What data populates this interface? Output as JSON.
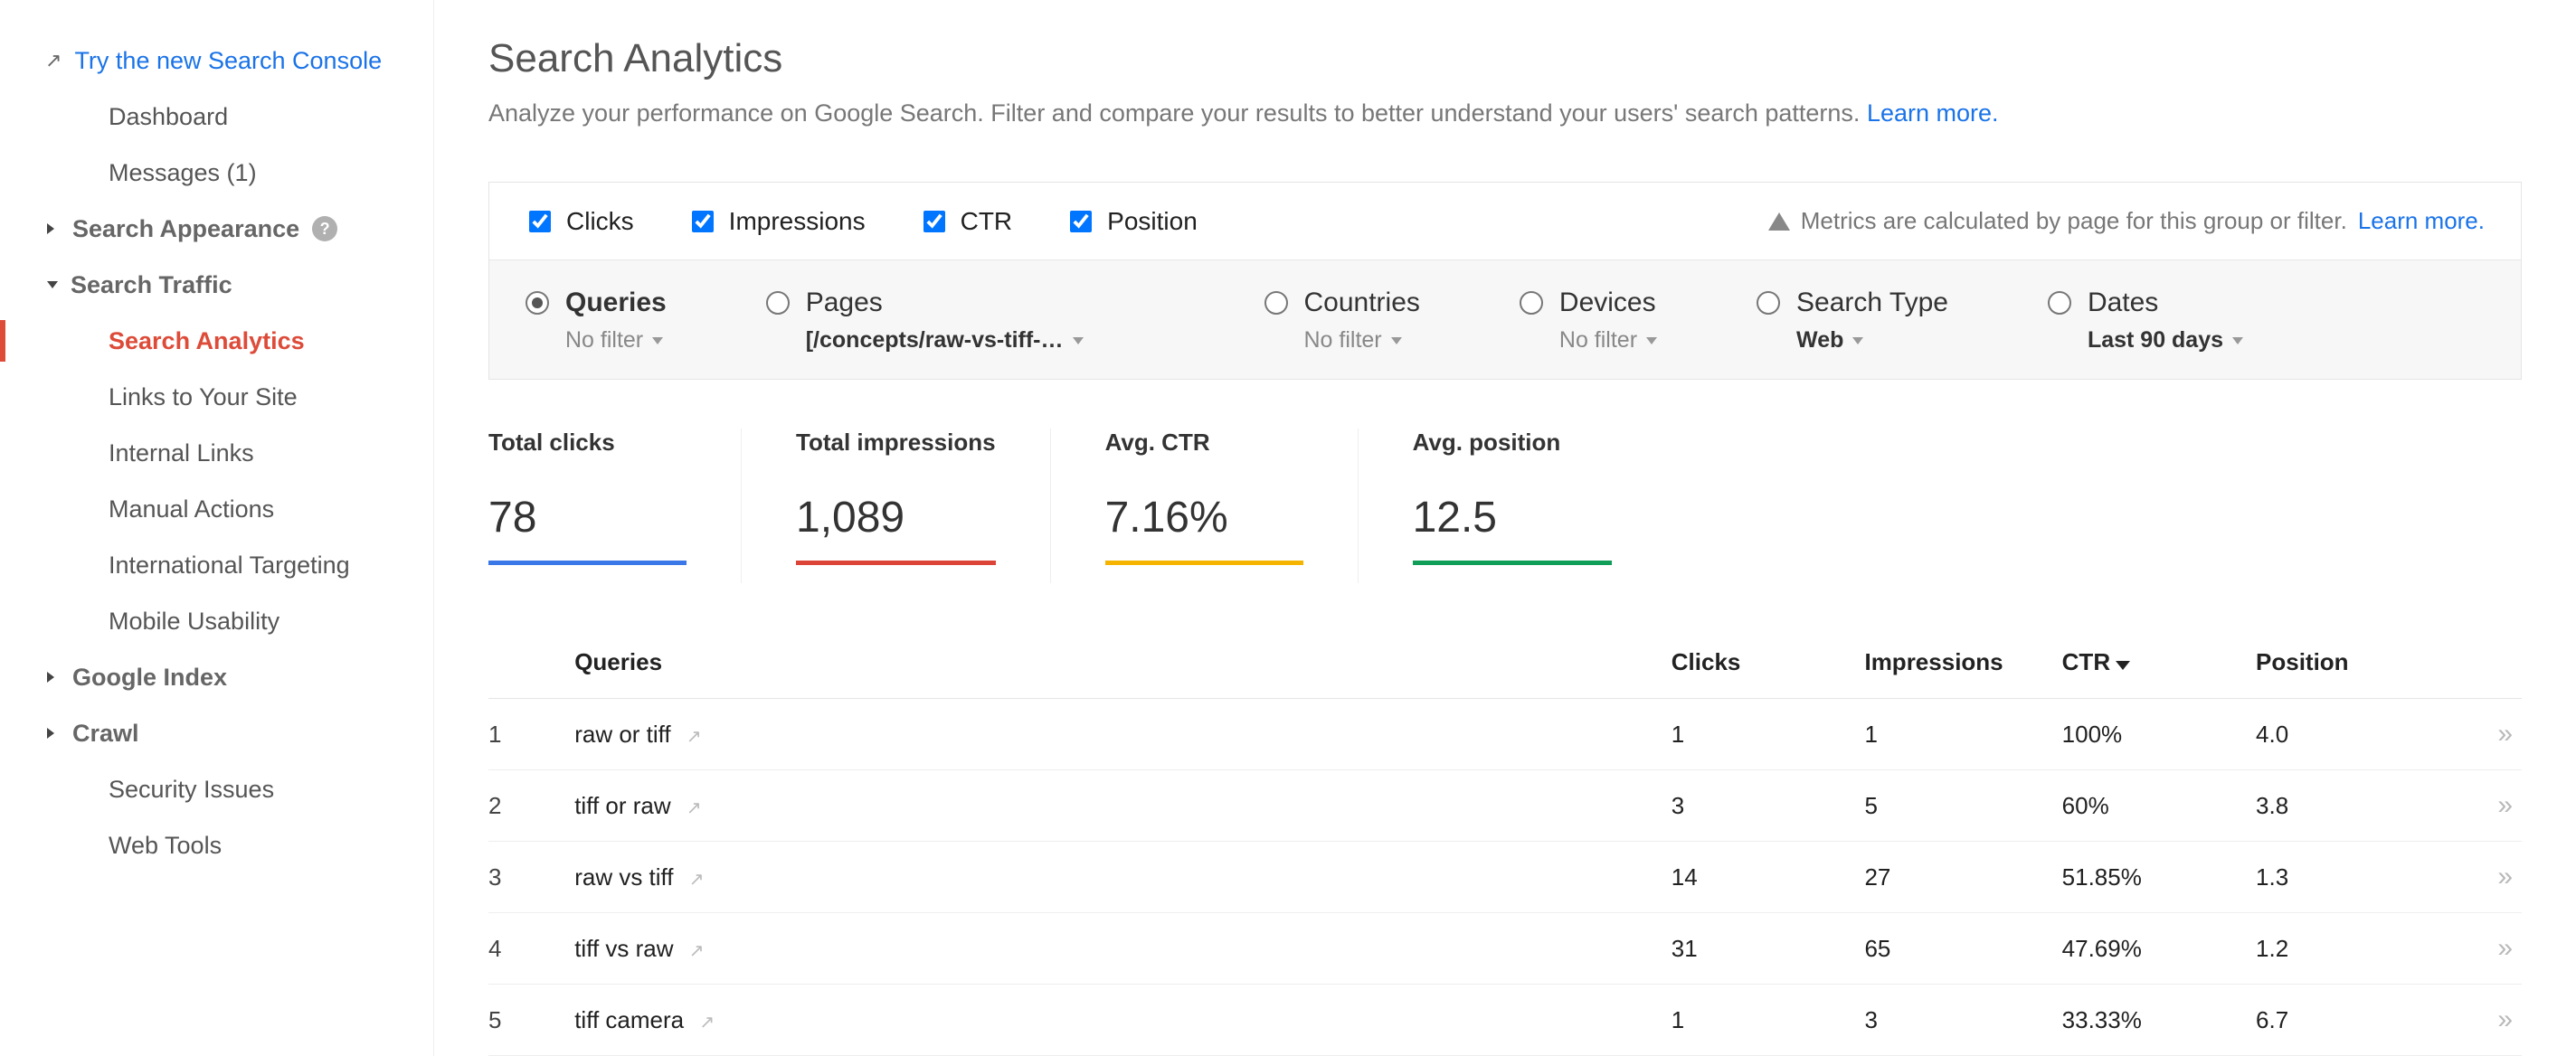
{
  "sidebar": {
    "try_link": "Try the new Search Console",
    "dashboard": "Dashboard",
    "messages": "Messages (1)",
    "search_appearance": "Search Appearance",
    "search_traffic": "Search Traffic",
    "traffic_children": {
      "search_analytics": "Search Analytics",
      "links_to_site": "Links to Your Site",
      "internal_links": "Internal Links",
      "manual_actions": "Manual Actions",
      "intl_targeting": "International Targeting",
      "mobile_usability": "Mobile Usability"
    },
    "google_index": "Google Index",
    "crawl": "Crawl",
    "security_issues": "Security Issues",
    "web_tools": "Web Tools"
  },
  "header": {
    "title": "Search Analytics",
    "desc_before": "Analyze your performance on Google Search. Filter and compare your results to better understand your users' search patterns. ",
    "learn_more": "Learn more."
  },
  "metric_checks": {
    "clicks": "Clicks",
    "impressions": "Impressions",
    "ctr": "CTR",
    "position": "Position"
  },
  "metric_notice": {
    "text": "Metrics are calculated by page for this group or filter. ",
    "link": "Learn more."
  },
  "filters": {
    "queries": {
      "label": "Queries",
      "sub": "No filter"
    },
    "pages": {
      "label": "Pages",
      "sub": "[/concepts/raw-vs-tiff-…"
    },
    "countries": {
      "label": "Countries",
      "sub": "No filter"
    },
    "devices": {
      "label": "Devices",
      "sub": "No filter"
    },
    "search_type": {
      "label": "Search Type",
      "sub": "Web"
    },
    "dates": {
      "label": "Dates",
      "sub": "Last 90 days"
    }
  },
  "summary": {
    "clicks": {
      "label": "Total clicks",
      "value": "78"
    },
    "impressions": {
      "label": "Total impressions",
      "value": "1,089"
    },
    "ctr": {
      "label": "Avg. CTR",
      "value": "7.16%"
    },
    "position": {
      "label": "Avg. position",
      "value": "12.5"
    }
  },
  "table": {
    "headers": {
      "queries": "Queries",
      "clicks": "Clicks",
      "impressions": "Impressions",
      "ctr": "CTR",
      "position": "Position"
    },
    "rows": [
      {
        "idx": "1",
        "query": "raw or tiff",
        "clicks": "1",
        "impressions": "1",
        "ctr": "100%",
        "position": "4.0"
      },
      {
        "idx": "2",
        "query": "tiff or raw",
        "clicks": "3",
        "impressions": "5",
        "ctr": "60%",
        "position": "3.8"
      },
      {
        "idx": "3",
        "query": "raw vs tiff",
        "clicks": "14",
        "impressions": "27",
        "ctr": "51.85%",
        "position": "1.3"
      },
      {
        "idx": "4",
        "query": "tiff vs raw",
        "clicks": "31",
        "impressions": "65",
        "ctr": "47.69%",
        "position": "1.2"
      },
      {
        "idx": "5",
        "query": "tiff camera",
        "clicks": "1",
        "impressions": "3",
        "ctr": "33.33%",
        "position": "6.7"
      }
    ]
  },
  "chart_data": {
    "type": "table",
    "title": "Search Analytics — queries for [/concepts/raw-vs-tiff-…] — Last 90 days",
    "columns": [
      "Query",
      "Clicks",
      "Impressions",
      "CTR (%)",
      "Position"
    ],
    "rows": [
      [
        "raw or tiff",
        1,
        1,
        100.0,
        4.0
      ],
      [
        "tiff or raw",
        3,
        5,
        60.0,
        3.8
      ],
      [
        "raw vs tiff",
        14,
        27,
        51.85,
        1.3
      ],
      [
        "tiff vs raw",
        31,
        65,
        47.69,
        1.2
      ],
      [
        "tiff camera",
        1,
        3,
        33.33,
        6.7
      ]
    ],
    "totals": {
      "clicks": 78,
      "impressions": 1089,
      "avg_ctr_pct": 7.16,
      "avg_position": 12.5
    },
    "sorted_by": "CTR",
    "sort_dir": "desc"
  }
}
